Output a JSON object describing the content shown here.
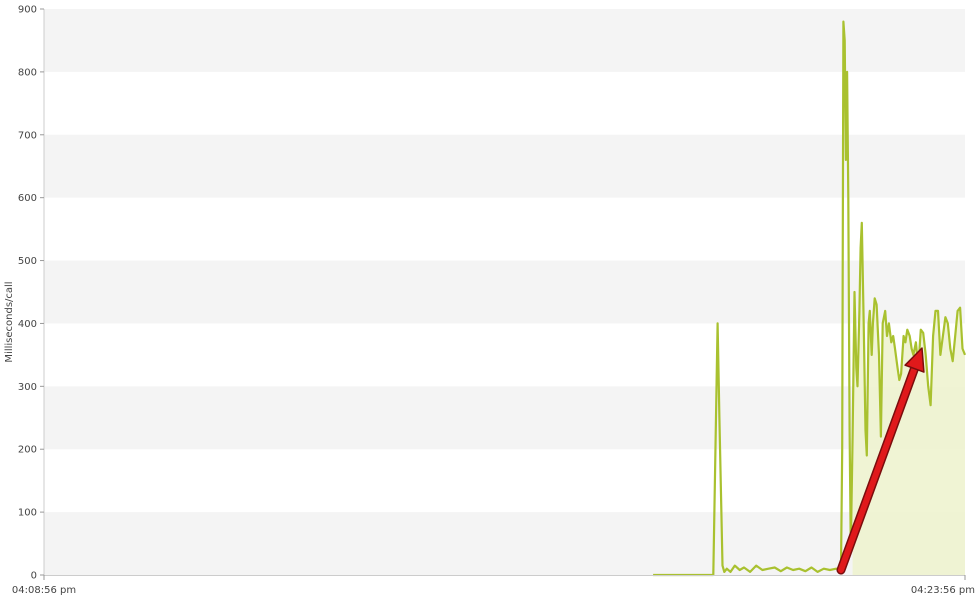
{
  "chart_data": {
    "type": "area",
    "title": "",
    "xlabel": "",
    "ylabel": "Milliseconds/call",
    "ylim": [
      0,
      900
    ],
    "y_ticks": [
      "0",
      "100",
      "200",
      "300",
      "400",
      "500",
      "600",
      "700",
      "800",
      "900"
    ],
    "x_ticks": [
      "04:08:56 pm",
      "04:23:56 pm"
    ],
    "x_range_minutes": [
      0,
      15
    ],
    "grid": "alternating horizontal bands",
    "legend": "none",
    "colors": {
      "line": "#a9c12f",
      "fill": "#eef3cf",
      "band": "#f4f4f4",
      "arrow": "#e0191b"
    },
    "annotations": [
      {
        "type": "arrow",
        "description": "red arrow pointing up-right at the rising response time"
      }
    ],
    "series": [
      {
        "x_minutes": [
          9.92,
          10.25,
          10.9,
          10.97,
          11.0,
          11.05,
          11.08,
          11.12,
          11.18,
          11.25,
          11.33,
          11.4,
          11.5,
          11.6,
          11.7,
          11.8,
          11.9,
          12.0,
          12.1,
          12.2,
          12.3,
          12.4,
          12.5,
          12.6,
          12.7,
          12.8,
          12.9,
          12.98,
          13.0,
          13.02,
          13.04,
          13.06,
          13.08,
          13.1,
          13.12,
          13.14,
          13.17,
          13.2,
          13.23,
          13.25,
          13.28,
          13.3,
          13.32,
          13.35,
          13.38,
          13.4,
          13.43,
          13.45,
          13.48,
          13.5,
          13.53,
          13.56,
          13.6,
          13.63,
          13.66,
          13.7,
          13.73,
          13.76,
          13.8,
          13.83,
          13.86,
          13.9,
          13.93,
          13.96,
          14.0,
          14.03,
          14.06,
          14.1,
          14.13,
          14.16,
          14.2,
          14.24,
          14.28,
          14.32,
          14.36,
          14.4,
          14.44,
          14.48,
          14.52,
          14.56,
          14.6,
          14.64,
          14.68,
          14.72,
          14.76,
          14.8,
          14.84,
          14.88,
          14.92,
          14.96,
          15.0
        ],
        "values": [
          0,
          0,
          0,
          400,
          250,
          15,
          5,
          10,
          5,
          15,
          8,
          12,
          5,
          15,
          8,
          10,
          12,
          6,
          12,
          8,
          10,
          6,
          12,
          5,
          10,
          8,
          10,
          10,
          200,
          880,
          850,
          660,
          800,
          600,
          230,
          40,
          220,
          450,
          330,
          300,
          420,
          520,
          560,
          400,
          230,
          190,
          400,
          420,
          350,
          400,
          440,
          430,
          350,
          220,
          400,
          420,
          380,
          400,
          370,
          380,
          360,
          330,
          310,
          320,
          380,
          370,
          390,
          380,
          360,
          350,
          370,
          330,
          390,
          385,
          350,
          300,
          270,
          380,
          420,
          420,
          350,
          380,
          410,
          400,
          360,
          340,
          380,
          420,
          425,
          360,
          350
        ]
      }
    ]
  }
}
